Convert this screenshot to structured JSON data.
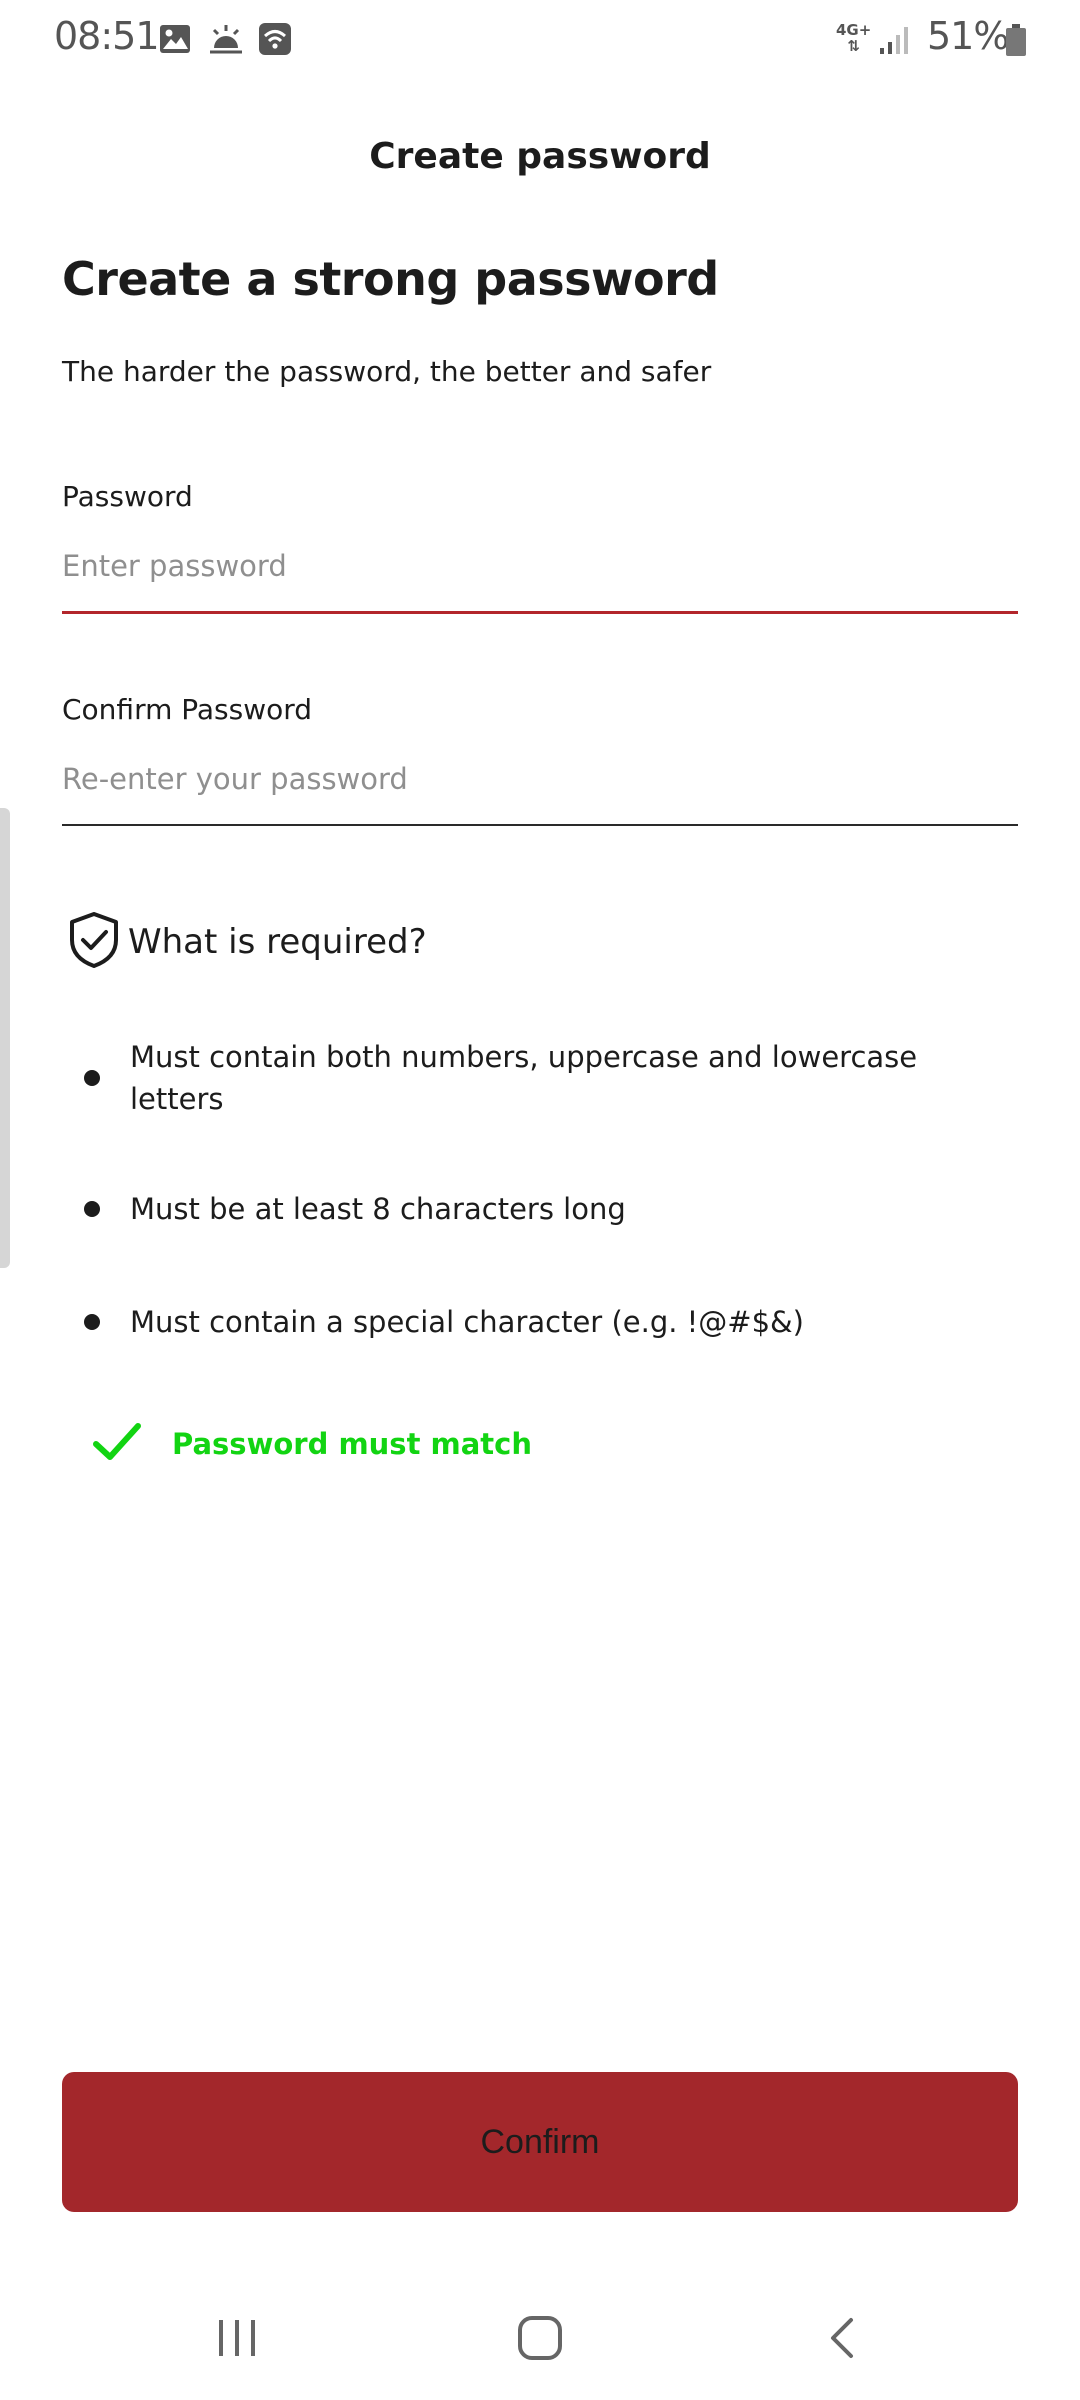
{
  "status_bar": {
    "time": "08:51",
    "icons": [
      "image-icon",
      "weather-icon",
      "wifi-icon"
    ],
    "network": "4G+",
    "battery": "51%"
  },
  "header": {
    "title": "Create password"
  },
  "main": {
    "headline": "Create a strong password",
    "subtitle": "The harder the password, the better and safer",
    "password": {
      "label": "Password",
      "placeholder": "Enter password",
      "value": ""
    },
    "confirm_password": {
      "label": "Confirm Password",
      "placeholder": "Re-enter your password",
      "value": ""
    },
    "requirements": {
      "title": "What is required?",
      "items": [
        "Must contain both numbers, uppercase and lowercase letters",
        "Must be at least 8 characters long",
        "Must contain a special character (e.g. !@#$&)"
      ],
      "match_text": "Password must match"
    }
  },
  "confirm_button": {
    "label": "Confirm"
  },
  "colors": {
    "accent": "#a3272b",
    "password_underline": "#b3262b",
    "confirm_underline": "#2a2a2a",
    "success": "#12d412"
  },
  "nav_bar": {
    "icons": [
      "recent-apps-icon",
      "home-icon",
      "back-icon"
    ]
  }
}
